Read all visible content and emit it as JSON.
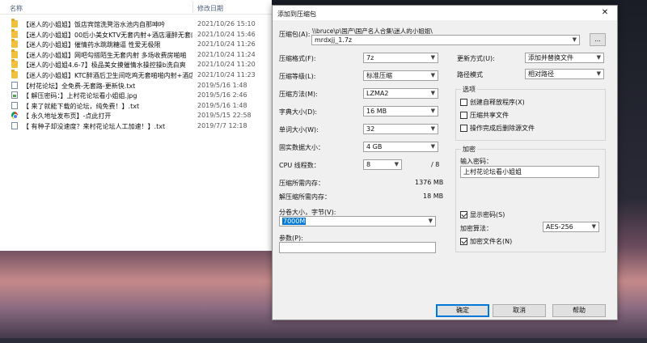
{
  "explorer": {
    "col_name": "名称",
    "col_date": "修改日期",
    "files": [
      {
        "name": "【迷人的小姐姐】饭店宾馆洗凳浴水池内自那呻吟",
        "date": "2021/10/26 15:10",
        "icon": "folder-icon"
      },
      {
        "name": "【迷人的小姐姐】00后小美女KTV无套内射+酒店灌醉无套内射",
        "date": "2021/10/24 15:46",
        "icon": "folder-icon"
      },
      {
        "name": "【迷人的小姐姐】催情药水跳跳糖逼 性爱无极限",
        "date": "2021/10/24 11:26",
        "icon": "folder-icon"
      },
      {
        "name": "【迷人的小姐姐】网吧勾搭陌生无套内射 多场收费房啪啪",
        "date": "2021/10/24 11:24",
        "icon": "folder-icon"
      },
      {
        "name": "【迷人的小姐姐4.6-7】极品美女摸催情水操控操b洗白爽",
        "date": "2021/10/24 11:20",
        "icon": "folder-icon"
      },
      {
        "name": "【迷人的小姐姐】KTC醉酒后卫生间吃鸡无套啪啪内射+酒店",
        "date": "2021/10/24 11:23",
        "icon": "folder-icon"
      },
      {
        "name": "【村花论坛】全免费-无套路-更新快.txt",
        "date": "2019/5/16 1:48",
        "icon": "doc-icon"
      },
      {
        "name": "【 解压密码：】上村花论坛看小姐姐.jpg",
        "date": "2019/5/16 2:46",
        "icon": "img-icon"
      },
      {
        "name": "【 来了就能下载的论坛，纯免费！】.txt",
        "date": "2019/5/16 1:48",
        "icon": "doc-icon"
      },
      {
        "name": "【 永久地址发布页】-点此打开",
        "date": "2019/5/15 22:58",
        "icon": "chrome-icon"
      },
      {
        "name": "【 有种子却没速度？来村花论坛人工加速！】.txt",
        "date": "2019/7/7 12:18",
        "icon": "doc-icon"
      }
    ]
  },
  "dialog": {
    "title": "添加到压缩包",
    "close": "✕",
    "archive_label": "压缩包(A):",
    "archive_path": "\\\\bruce\\p\\国产\\国产名人合集\\迷人的小姐姐\\",
    "archive_name": "mrdxjj_1.7z",
    "browse": "...",
    "format_label": "压缩格式(F):",
    "format_value": "7z",
    "level_label": "压缩等级(L):",
    "level_value": "标准压缩",
    "method_label": "压缩方法(M):",
    "method_value": "LZMA2",
    "dict_label": "字典大小(D):",
    "dict_value": "16 MB",
    "word_label": "单词大小(W):",
    "word_value": "32",
    "solid_label": "固实数据大小：",
    "solid_value": "4 GB",
    "cpu_label": "CPU 线程数：",
    "cpu_value": "8",
    "cpu_total": "/ 8",
    "mem_comp_label": "压缩所需内存：",
    "mem_comp_value": "1376 MB",
    "mem_decomp_label": "解压缩所需内存：",
    "mem_decomp_value": "18 MB",
    "split_label": "分卷大小，字节(V):",
    "split_value": "7000M",
    "params_label": "参数(P):",
    "params_value": "",
    "update_label": "更新方式(U):",
    "update_value": "添加并替换文件",
    "pathmode_label": "路径模式",
    "pathmode_value": "相对路径",
    "options_title": "选项",
    "opt_sfx": "创建自释放程序(X)",
    "opt_shared": "压缩共享文件",
    "opt_delete": "操作完成后删除源文件",
    "enc_title": "加密",
    "enc_pwd_label": "输入密码：",
    "enc_pwd_value": "上村花论坛看小姐姐",
    "show_pwd": "显示密码(S)",
    "enc_method_label": "加密算法：",
    "enc_method_value": "AES-256",
    "enc_names": "加密文件名(N)",
    "ok": "确定",
    "cancel": "取消",
    "help": "帮助"
  }
}
